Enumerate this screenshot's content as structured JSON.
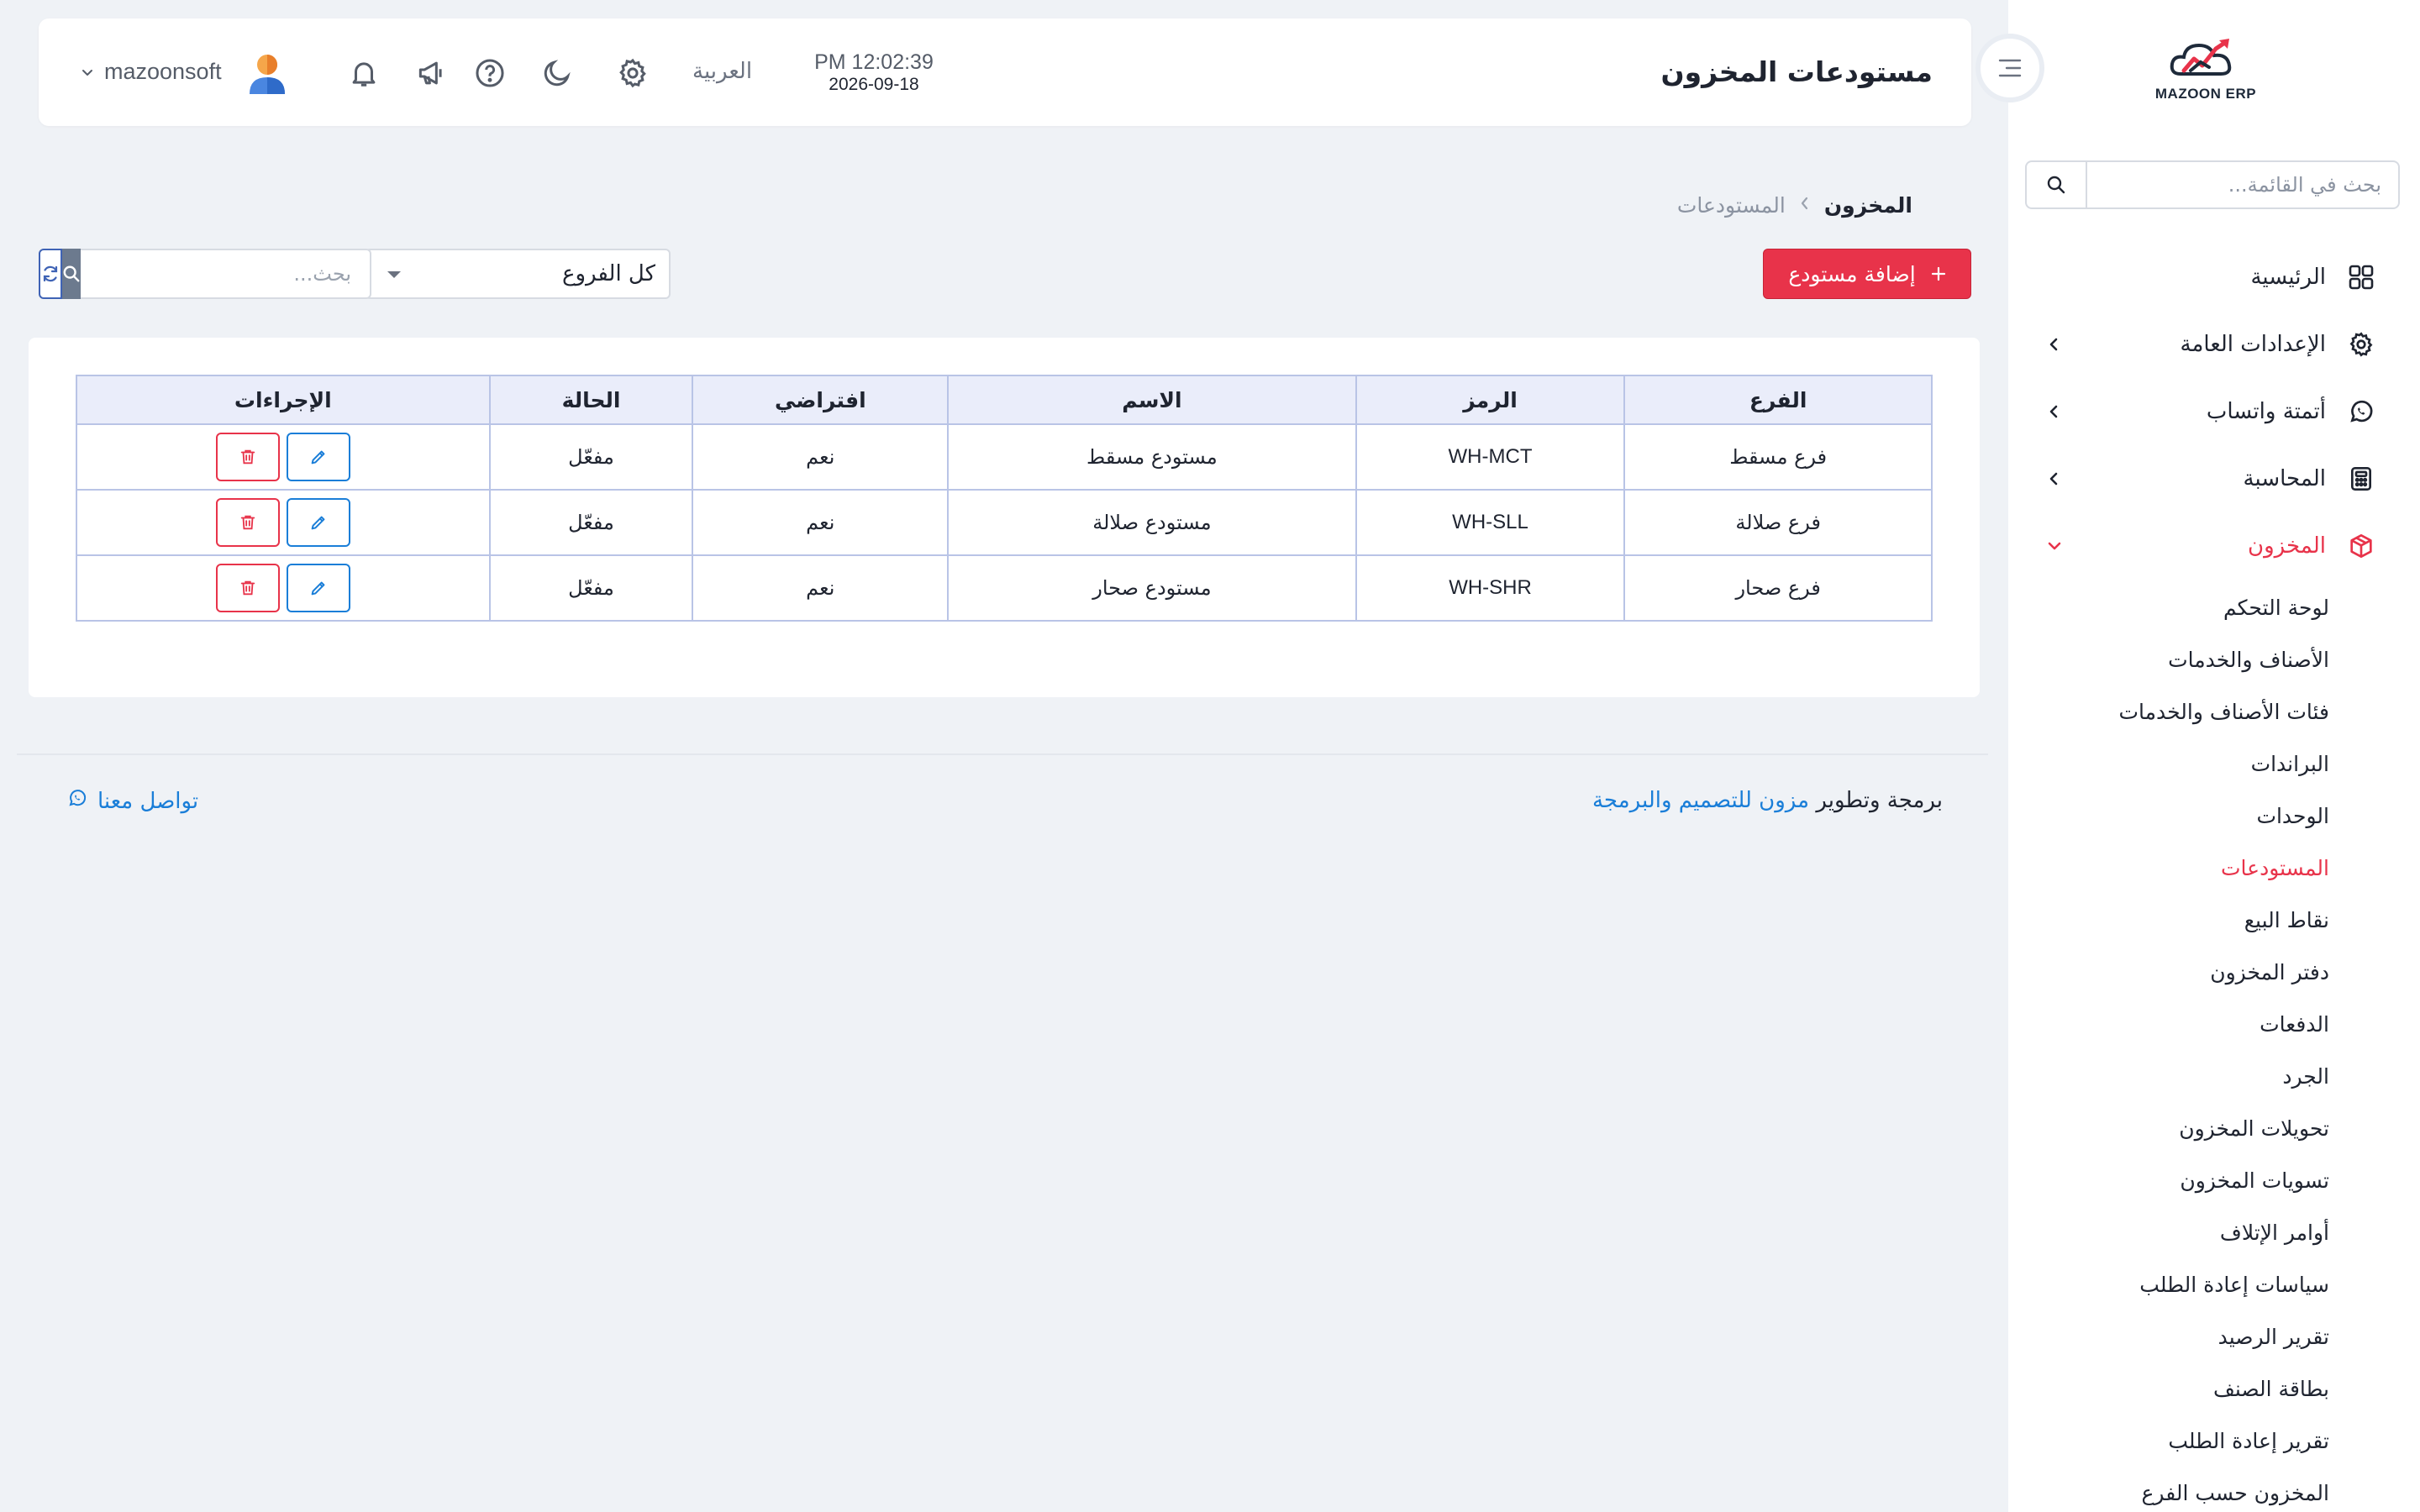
{
  "brand": {
    "logo_text": "MAZOON ERP",
    "accent": "#e8334a",
    "link_color": "#1a7ed8"
  },
  "sidebar": {
    "search_placeholder": "بحث في القائمة...",
    "items": [
      {
        "label": "الرئيسية",
        "icon": "grid-icon"
      },
      {
        "label": "الإعدادات العامة",
        "icon": "gear-icon"
      },
      {
        "label": "أتمتة واتساب",
        "icon": "whatsapp-icon"
      },
      {
        "label": "المحاسبة",
        "icon": "calculator-icon"
      },
      {
        "label": "المخزون",
        "icon": "box-icon",
        "active": true
      }
    ],
    "inventory_sub": [
      "لوحة التحكم",
      "الأصناف والخدمات",
      "فئات الأصناف والخدمات",
      "البراندات",
      "الوحدات",
      "المستودعات",
      "نقاط البيع",
      "دفتر المخزون",
      "الدفعات",
      "الجرد",
      "تحويلات المخزون",
      "تسويات المخزون",
      "أوامر الإتلاف",
      "سياسات إعادة الطلب",
      "تقرير الرصيد",
      "بطاقة الصنف",
      "تقرير إعادة الطلب",
      "المخزون حسب الفرع"
    ]
  },
  "header": {
    "title": "مستودعات المخزون",
    "time": "PM 12:02:39",
    "date": "2026-09-18",
    "language": "العربية",
    "username": "mazoonsoft"
  },
  "breadcrumb": {
    "root": "المخزون",
    "current": "المستودعات"
  },
  "toolbar": {
    "add_label": "إضافة مستودع",
    "branch_filter": "كل الفروع",
    "search_placeholder": "بحث..."
  },
  "table": {
    "columns": [
      "الفرع",
      "الرمز",
      "الاسم",
      "افتراضي",
      "الحالة",
      "الإجراءات"
    ],
    "rows": [
      {
        "branch": "فرع مسقط",
        "code": "WH-MCT",
        "name": "مستودع مسقط",
        "default": "نعم",
        "status": "مفعّل"
      },
      {
        "branch": "فرع صلالة",
        "code": "WH-SLL",
        "name": "مستودع صلالة",
        "default": "نعم",
        "status": "مفعّل"
      },
      {
        "branch": "فرع صحار",
        "code": "WH-SHR",
        "name": "مستودع صحار",
        "default": "نعم",
        "status": "مفعّل"
      }
    ]
  },
  "footer": {
    "credit_prefix": "برمجة وتطوير",
    "credit_link": "مزون للتصميم والبرمجة",
    "contact": "تواصل معنا"
  }
}
